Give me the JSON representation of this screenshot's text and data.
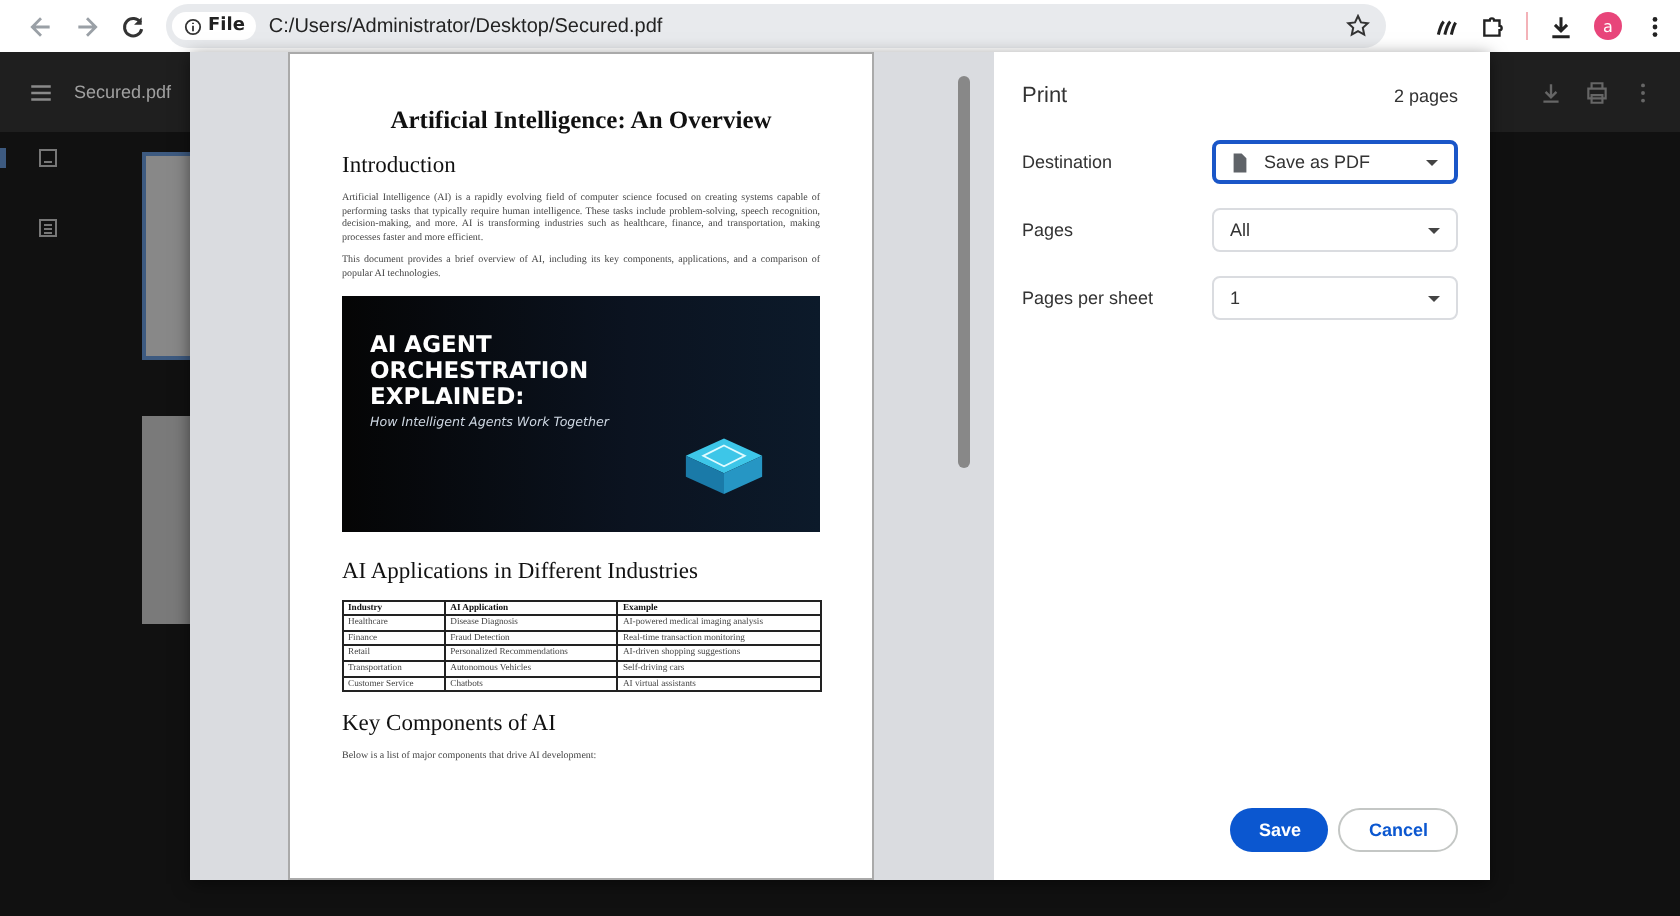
{
  "browser": {
    "address_chip": "File",
    "url": "C:/Users/Administrator/Desktop/Secured.pdf",
    "profile_initial": "a"
  },
  "viewer": {
    "filename": "Secured.pdf",
    "sidebar_tabs": [
      {
        "kind": "thumbnails",
        "selected": true
      },
      {
        "kind": "outline",
        "selected": false
      }
    ],
    "thumbnails": [
      {
        "selected": true
      },
      {
        "selected": false
      }
    ]
  },
  "document": {
    "title": "Artificial Intelligence: An Overview",
    "intro_heading": "Introduction",
    "paragraphs": [
      "Artificial Intelligence (AI) is a rapidly evolving field of computer science focused on creating systems capable of performing tasks that typically require human intelligence. These tasks include problem-solving, speech recognition, decision-making, and more. AI is transforming industries such as healthcare, finance, and transportation, making processes faster and more efficient.",
      "This document provides a brief overview of AI, including its key components, applications, and a comparison of popular AI technologies."
    ],
    "banner": {
      "headline": [
        "AI AGENT",
        "ORCHESTRATION",
        "EXPLAINED:"
      ],
      "subtitle": "How Intelligent Agents Work Together"
    },
    "applications_heading": "AI Applications in Different Industries",
    "table": {
      "columns": [
        "Industry",
        "AI Application",
        "Example"
      ],
      "rows": [
        [
          "Healthcare",
          "Disease Diagnosis",
          "AI-powered medical imaging analysis"
        ],
        [
          "Finance",
          "Fraud Detection",
          "Real-time transaction monitoring"
        ],
        [
          "Retail",
          "Personalized Recommendations",
          "AI-driven shopping suggestions"
        ],
        [
          "Transportation",
          "Autonomous Vehicles",
          "Self-driving cars"
        ],
        [
          "Customer Service",
          "Chatbots",
          "AI virtual assistants"
        ]
      ]
    },
    "components_heading": "Key Components of AI",
    "components_text": "Below is a list of major components that drive AI development:"
  },
  "print": {
    "title": "Print",
    "page_count": "2 pages",
    "settings": [
      {
        "label": "Destination",
        "value": "Save as PDF",
        "kind": "destination",
        "focused": true
      },
      {
        "label": "Pages",
        "value": "All",
        "kind": "plain",
        "focused": false
      },
      {
        "label": "Pages per sheet",
        "value": "1",
        "kind": "plain",
        "focused": false
      }
    ],
    "buttons": [
      {
        "label": "Save",
        "kind": "primary"
      },
      {
        "label": "Cancel",
        "kind": "secondary"
      }
    ]
  }
}
